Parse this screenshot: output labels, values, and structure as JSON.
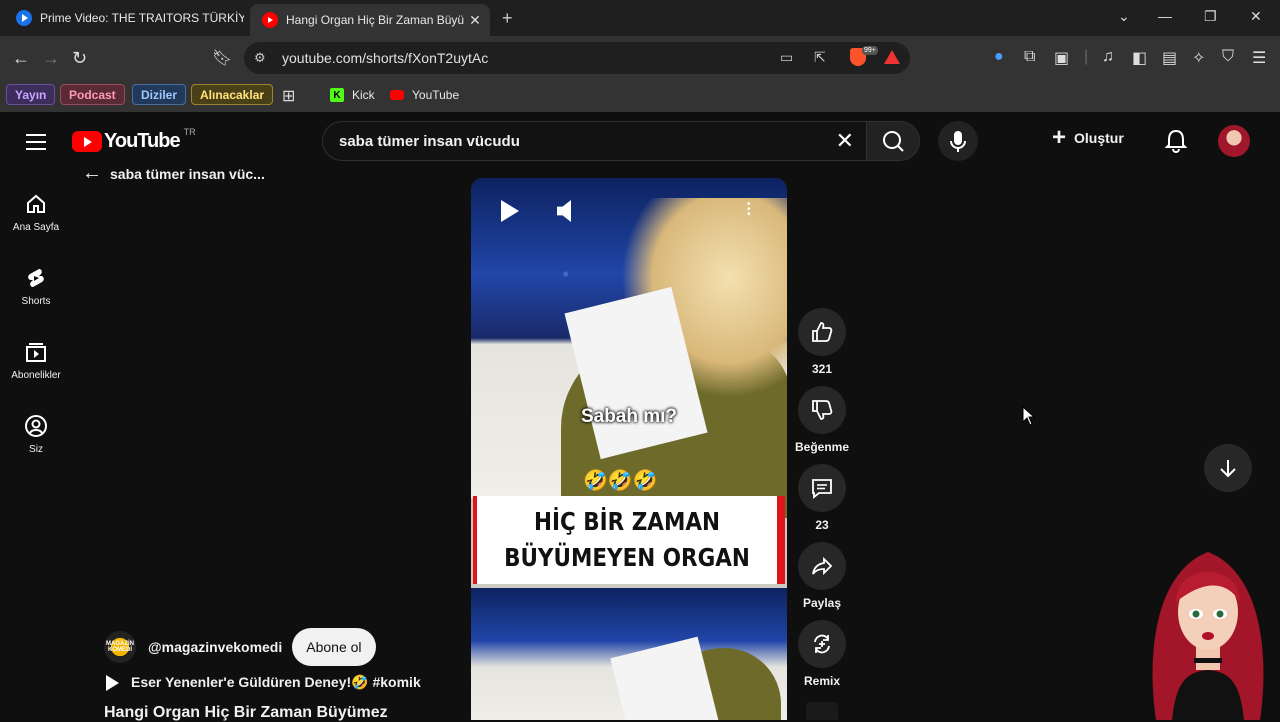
{
  "browser": {
    "tabs": [
      {
        "title": "Prime Video: THE TRAITORS TÜRKİYE",
        "active": false
      },
      {
        "title": "Hangi Organ Hiç Bir Zaman Büyü",
        "active": true
      }
    ],
    "new_tab": "+",
    "url": "youtube.com/shorts/fXonT2uytAc",
    "brave_badge": "99+"
  },
  "bookmarks": {
    "chips": [
      "Yayın",
      "Podcast",
      "Diziler",
      "Alınacaklar"
    ],
    "links": [
      {
        "label": "Kick",
        "icon": "kick-icon"
      },
      {
        "label": "YouTube",
        "icon": "youtube-icon"
      }
    ]
  },
  "youtube": {
    "logo_text": "YouTube",
    "country": "TR",
    "search_value": "saba tümer insan vücudu",
    "create_label": "Oluştur",
    "back_label": "saba tümer insan vüc...",
    "sidebar": [
      {
        "label": "Ana Sayfa",
        "icon": "home-icon"
      },
      {
        "label": "Shorts",
        "icon": "shorts-icon"
      },
      {
        "label": "Abonelikler",
        "icon": "subscriptions-icon"
      },
      {
        "label": "Siz",
        "icon": "you-icon"
      }
    ],
    "short": {
      "caption": "Sabah mı?",
      "banner_line1": "HİÇ BİR ZAMAN",
      "banner_line2": "BÜYÜMEYEN ORGAN",
      "emojis": "🤣🤣🤣"
    },
    "actions": [
      {
        "label": "321",
        "icon": "like-icon"
      },
      {
        "label": "Beğenme",
        "icon": "dislike-icon"
      },
      {
        "label": "23",
        "icon": "comment-icon"
      },
      {
        "label": "Paylaş",
        "icon": "share-icon"
      },
      {
        "label": "Remix",
        "icon": "remix-icon"
      }
    ],
    "channel": {
      "handle": "@magazinvekomedi",
      "avatar_text": "MAGAZİN KOMEDİ",
      "subscribe_label": "Abone ol"
    },
    "music": "Eser Yenenler'e Güldüren Deney!🤣 #komik",
    "video_title": "Hangi Organ Hiç Bir Zaman Büyümez"
  }
}
